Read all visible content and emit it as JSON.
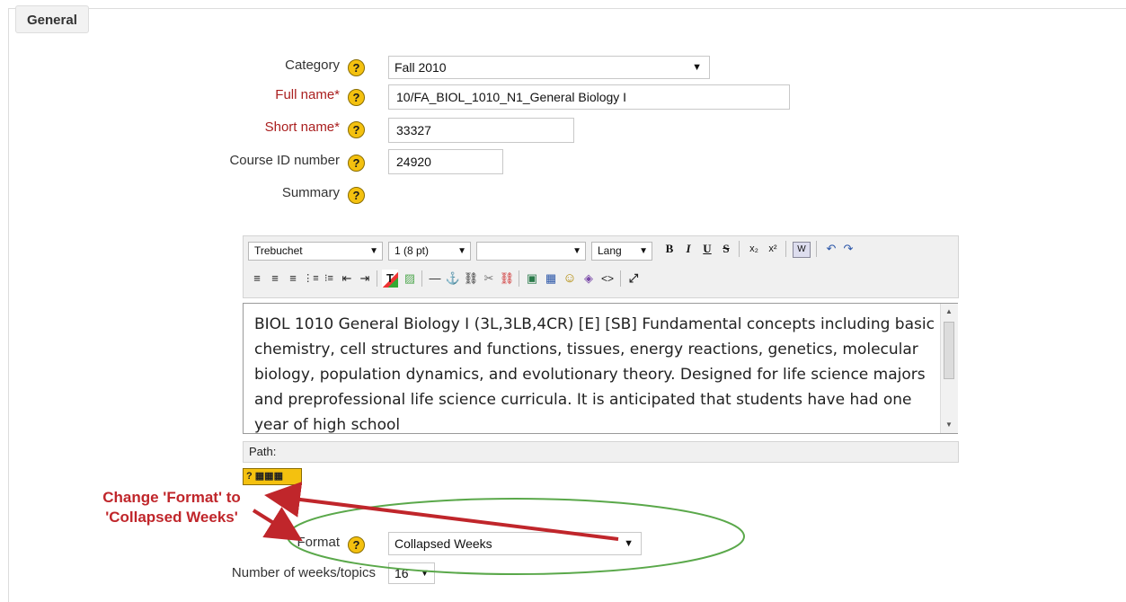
{
  "legend": {
    "label": "General"
  },
  "fields": {
    "category": {
      "label": "Category",
      "value": "Fall 2010"
    },
    "fullname": {
      "label": "Full name",
      "required_mark": "*",
      "value": "10/FA_BIOL_1010_N1_General Biology I"
    },
    "shortname": {
      "label": "Short name",
      "required_mark": "*",
      "value": "33327"
    },
    "idnumber": {
      "label": "Course ID number",
      "value": "24920"
    },
    "summary": {
      "label": "Summary"
    },
    "format": {
      "label": "Format",
      "value": "Collapsed Weeks"
    },
    "numweeks": {
      "label": "Number of weeks/topics",
      "value": "16"
    }
  },
  "help_glyph": "?",
  "editor": {
    "font_family": "Trebuchet",
    "font_size": "1 (8 pt)",
    "style": "",
    "lang": "Lang",
    "text": "BIOL 1010 General Biology I (3L,3LB,4CR) [E] [SB] Fundamental concepts including basic chemistry, cell structures and functions, tissues, energy reactions, genetics, molecular biology, population dynamics, and evolutionary theory. Designed for life science majors and preprofessional life science curricula. It is anticipated that students have had one year of high school",
    "path_label": "Path:",
    "buttons": {
      "bold": "B",
      "italic": "I",
      "underline": "U",
      "strike": "S",
      "sub": "x₂",
      "sup": "x²",
      "word": "W",
      "undo": "↶",
      "redo": "↷",
      "align_left": "≡",
      "align_center": "≡",
      "align_right": "≡",
      "ol": "⋮≡",
      "ul": "⁝≡",
      "outdent": "⇤",
      "indent": "⇥",
      "forecolor": "T",
      "backcolor": "▨",
      "hr": "—",
      "anchor": "⚓",
      "link": "⛓",
      "unlink": "✂",
      "nolink": "⛓",
      "image": "▣",
      "table": "▦",
      "smiley": "☺",
      "special": "◈",
      "html": "<>",
      "fullscreen": "⤢"
    }
  },
  "annotation": {
    "line1": "Change 'Format' to",
    "line2": "'Collapsed Weeks'"
  },
  "colors": {
    "required": "#aa1f1f",
    "annotation": "#c0262b",
    "ellipse": "#5aa84a",
    "help": "#f4c10f"
  }
}
